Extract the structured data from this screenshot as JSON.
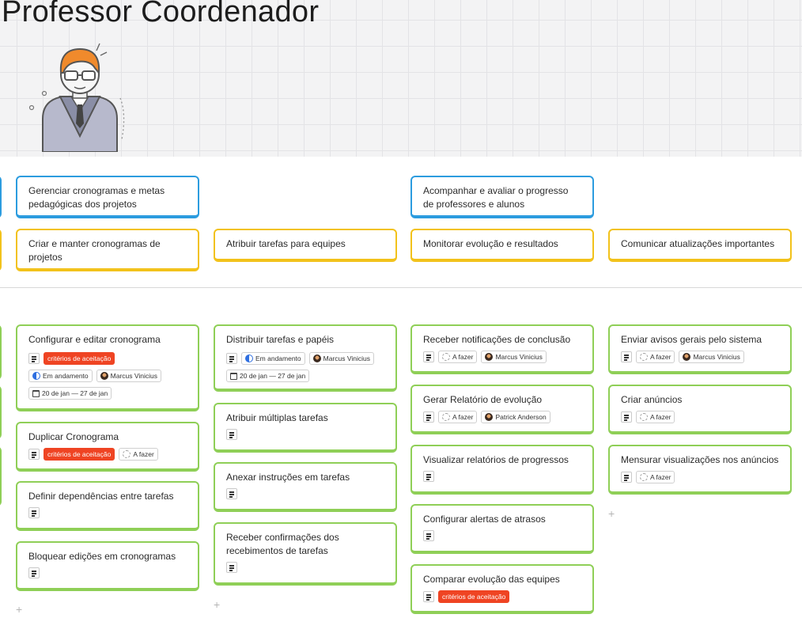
{
  "board": {
    "title": "Professor Coordenador"
  },
  "colors": {
    "activity": "#2c9cdf",
    "task": "#f2c21b",
    "story": "#8fcf57",
    "tag": "#ef4423",
    "in_progress": "#2f6fe0"
  },
  "activities": [
    "Gerenciar cronogramas e metas pedagógicas dos projetos",
    "Acompanhar e avaliar o progresso de professores e alunos"
  ],
  "tasks": [
    "Criar e manter cronogramas de projetos",
    "Atribuir tarefas para equipes",
    "Monitorar evolução e resultados",
    "Comunicar atualizações importantes"
  ],
  "labels": {
    "tag": "critérios de aceitação",
    "in_progress": "Em andamento",
    "todo": "A fazer",
    "dates": "20 de jan — 27 de jan",
    "add": "+"
  },
  "people": {
    "marcus": "Marcus Vinicius",
    "patrick": "Patrick Anderson"
  },
  "stories": {
    "col1": [
      "Configurar e editar cronograma",
      "Duplicar Cronograma",
      "Definir dependências entre tarefas",
      "Bloquear edições em cronogramas"
    ],
    "col2": [
      "Distribuir tarefas e papéis",
      "Atribuir múltiplas tarefas",
      "Anexar instruções em tarefas",
      "Receber confirmações dos recebimentos de tarefas"
    ],
    "col3": [
      "Receber notificações de conclusão",
      "Gerar Relatório de evolução",
      "Visualizar relatórios de progressos",
      "Configurar alertas de atrasos",
      "Comparar evolução das equipes"
    ],
    "col4": [
      "Enviar avisos gerais pelo sistema",
      "Criar anúncios",
      "Mensurar visualizações nos anúncios"
    ]
  }
}
